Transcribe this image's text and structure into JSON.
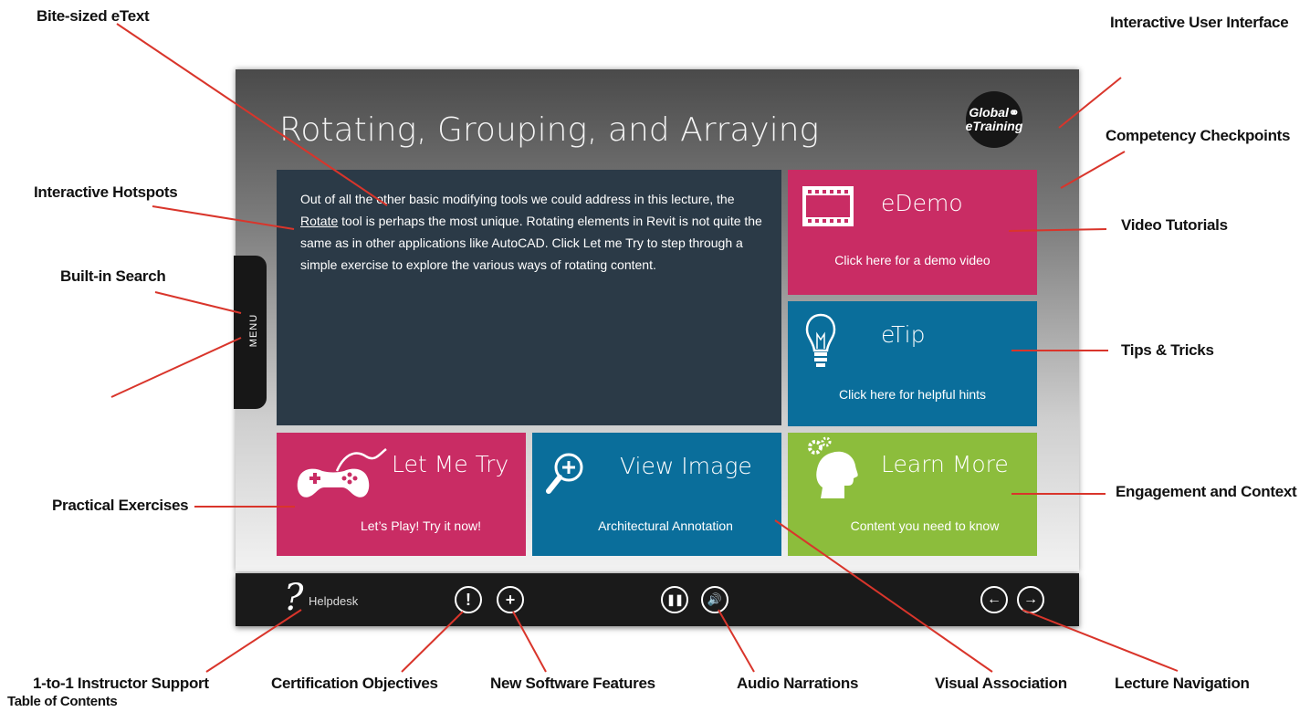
{
  "callouts": {
    "bite_sized": "Bite-sized eText",
    "interactive_ui": "Interactive User Interface",
    "competency": "Competency Checkpoints",
    "hotspots": "Interactive Hotspots",
    "video": "Video Tutorials",
    "search": "Built-in Search",
    "tips": "Tips & Tricks",
    "practical": "Practical Exercises",
    "engagement": "Engagement and Context",
    "instructor": "1-to-1 Instructor Support",
    "certification": "Certification Objectives",
    "new_features": "New Software Features",
    "audio": "Audio Narrations",
    "visual": "Visual Association",
    "navigation": "Lecture Navigation",
    "toc": "Table of Contents"
  },
  "screen": {
    "title": "Rotating, Grouping, and Arraying",
    "logo_line1": "Global",
    "logo_line2": "eTraining",
    "menu_label": "MENU",
    "text_part1": "Out of all the other basic modifying tools we could address in this lecture, the ",
    "text_link": "Rotate",
    "text_part2": " tool is perhaps the most unique.  Rotating elements in Revit is not quite the same as in other applications like AutoCAD.  Click Let me Try to step through a simple exercise to explore the various ways of rotating content."
  },
  "tiles": {
    "edemo": {
      "title": "eDemo",
      "sub": "Click here for a demo video"
    },
    "etip": {
      "title": "eTip",
      "sub": "Click here for helpful hints"
    },
    "letmetry": {
      "title": "Let Me Try",
      "sub": "Let’s Play! Try it now!"
    },
    "viewimage": {
      "title": "View Image",
      "sub": "Architectural Annotation"
    },
    "learnmore": {
      "title": "Learn More",
      "sub": "Content you need to know"
    }
  },
  "toolbar": {
    "help_glyph": "?",
    "helpdesk": "Helpdesk"
  },
  "icons": [
    "film-icon",
    "lightbulb-icon",
    "gamepad-icon",
    "magnifier-plus-icon",
    "head-gears-icon",
    "question-mark-icon",
    "exclamation-icon",
    "plus-icon",
    "pause-icon",
    "speaker-icon",
    "arrow-left-icon",
    "arrow-right-icon",
    "globe-icon"
  ],
  "colors": {
    "magenta": "#c92c64",
    "blue": "#0a6e9b",
    "green": "#8cbd3c",
    "slate": "#2b3a47",
    "callout_line": "#d9352b"
  }
}
